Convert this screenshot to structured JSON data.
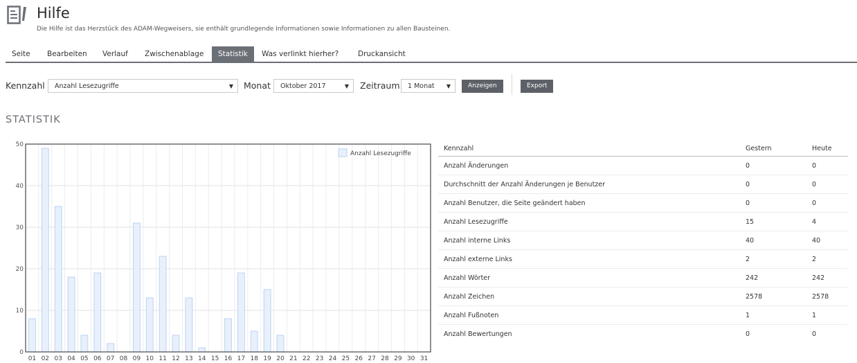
{
  "page": {
    "title": "Hilfe",
    "description": "Die Hilfe ist das Herzstück des ADAM-Wegweisers, sie enthält grundlegende Informationen sowie Informationen zu allen Bausteinen."
  },
  "tabs": [
    {
      "label": "Seite",
      "active": false
    },
    {
      "label": "Bearbeiten",
      "active": false
    },
    {
      "label": "Verlauf",
      "active": false
    },
    {
      "label": "Zwischenablage",
      "active": false
    },
    {
      "label": "Statistik",
      "active": true
    },
    {
      "label": "Was verlinkt hierher?",
      "active": false
    },
    {
      "label": "Druckansicht",
      "active": false
    }
  ],
  "toolbar": {
    "kennzahl_label": "Kennzahl",
    "kennzahl_value": "Anzahl Lesezugriffe",
    "monat_label": "Monat",
    "monat_value": "Oktober 2017",
    "zeitraum_label": "Zeitraum",
    "zeitraum_value": "1 Monat",
    "anzeigen_label": "Anzeigen",
    "export_label": "Export",
    "caret": "▼"
  },
  "section": {
    "title": "STATISTIK"
  },
  "chart_data": {
    "type": "bar",
    "categories": [
      "01",
      "02",
      "03",
      "04",
      "05",
      "06",
      "07",
      "08",
      "09",
      "10",
      "11",
      "12",
      "13",
      "14",
      "15",
      "16",
      "17",
      "18",
      "19",
      "20",
      "21",
      "22",
      "23",
      "24",
      "25",
      "26",
      "27",
      "28",
      "29",
      "30",
      "31"
    ],
    "series": [
      {
        "name": "Anzahl Lesezugriffe",
        "values": [
          8,
          49,
          35,
          18,
          4,
          19,
          2,
          0,
          31,
          13,
          23,
          4,
          13,
          1,
          0,
          8,
          19,
          5,
          15,
          4,
          0,
          0,
          0,
          0,
          0,
          0,
          0,
          0,
          0,
          0,
          0
        ]
      }
    ],
    "yticks": [
      0,
      10,
      20,
      30,
      40,
      50
    ],
    "ylim": [
      0,
      50
    ],
    "grid": true,
    "legend": "top-right",
    "bar_fill": "#e8f0fc",
    "bar_stroke": "#bcd2f2"
  },
  "stats_table": {
    "headers": [
      "Kennzahl",
      "Gestern",
      "Heute"
    ],
    "rows": [
      [
        "Anzahl Änderungen",
        "0",
        "0"
      ],
      [
        "Durchschnitt der Anzahl Änderungen je Benutzer",
        "0",
        "0"
      ],
      [
        "Anzahl Benutzer, die Seite geändert haben",
        "0",
        "0"
      ],
      [
        "Anzahl Lesezugriffe",
        "15",
        "4"
      ],
      [
        "Anzahl interne Links",
        "40",
        "40"
      ],
      [
        "Anzahl externe Links",
        "2",
        "2"
      ],
      [
        "Anzahl Wörter",
        "242",
        "242"
      ],
      [
        "Anzahl Zeichen",
        "2578",
        "2578"
      ],
      [
        "Anzahl Fußnoten",
        "1",
        "1"
      ],
      [
        "Anzahl Bewertungen",
        "0",
        "0"
      ]
    ]
  },
  "colors": {
    "tab_active": "#6b6f76",
    "button": "#5d6167",
    "heading": "#6b6f76"
  }
}
